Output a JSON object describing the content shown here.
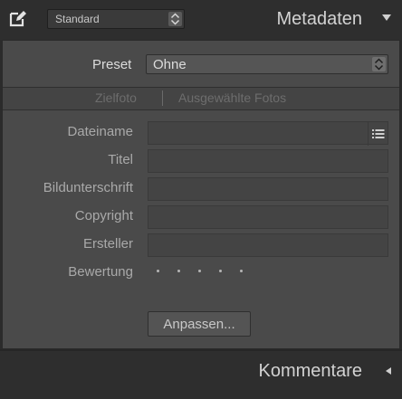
{
  "header": {
    "edit_icon": "edit-icon",
    "preset_select_value": "Standard",
    "title": "Metadaten",
    "collapse_icon": "triangle-down-icon"
  },
  "metadata": {
    "preset_label": "Preset",
    "preset_value": "Ohne",
    "tabs": [
      {
        "label": "Zielfoto"
      },
      {
        "label": "Ausgewählte Fotos"
      }
    ],
    "fields": [
      {
        "label": "Dateiname",
        "value": ""
      },
      {
        "label": "Titel",
        "value": ""
      },
      {
        "label": "Bildunterschrift",
        "value": ""
      },
      {
        "label": "Copyright",
        "value": ""
      },
      {
        "label": "Ersteller",
        "value": ""
      }
    ],
    "rating_label": "Bewertung",
    "rating_value": 0,
    "rating_max": 5,
    "adjust_button": "Anpassen..."
  },
  "footer": {
    "title": "Kommentare",
    "collapse_icon": "triangle-left-icon"
  }
}
